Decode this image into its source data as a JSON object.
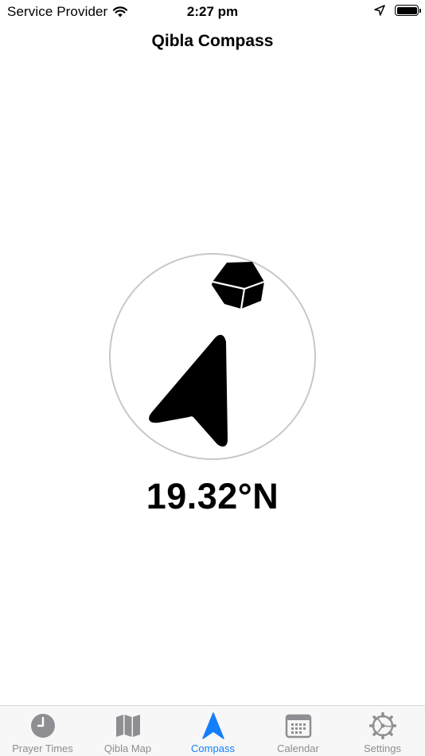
{
  "status_bar": {
    "carrier": "Service Provider",
    "time": "2:27 pm",
    "icons": [
      "wifi-icon",
      "location-arrow-icon",
      "battery-icon"
    ]
  },
  "nav": {
    "title": "Qibla Compass"
  },
  "compass": {
    "heading": "19.32°N",
    "icons": [
      "kaaba-icon",
      "compass-needle-icon"
    ]
  },
  "tabs": [
    {
      "label": "Prayer Times",
      "icon": "clock-icon",
      "active": false
    },
    {
      "label": "Qibla Map",
      "icon": "map-icon",
      "active": false
    },
    {
      "label": "Compass",
      "icon": "compass-arrow-icon",
      "active": true
    },
    {
      "label": "Calendar",
      "icon": "calendar-icon",
      "active": false
    },
    {
      "label": "Settings",
      "icon": "gear-icon",
      "active": false
    }
  ],
  "colors": {
    "accent": "#147efb",
    "inactive": "#8e8e93",
    "tab_bar_bg": "#f7f7f7",
    "ring": "#c8c8c8"
  }
}
